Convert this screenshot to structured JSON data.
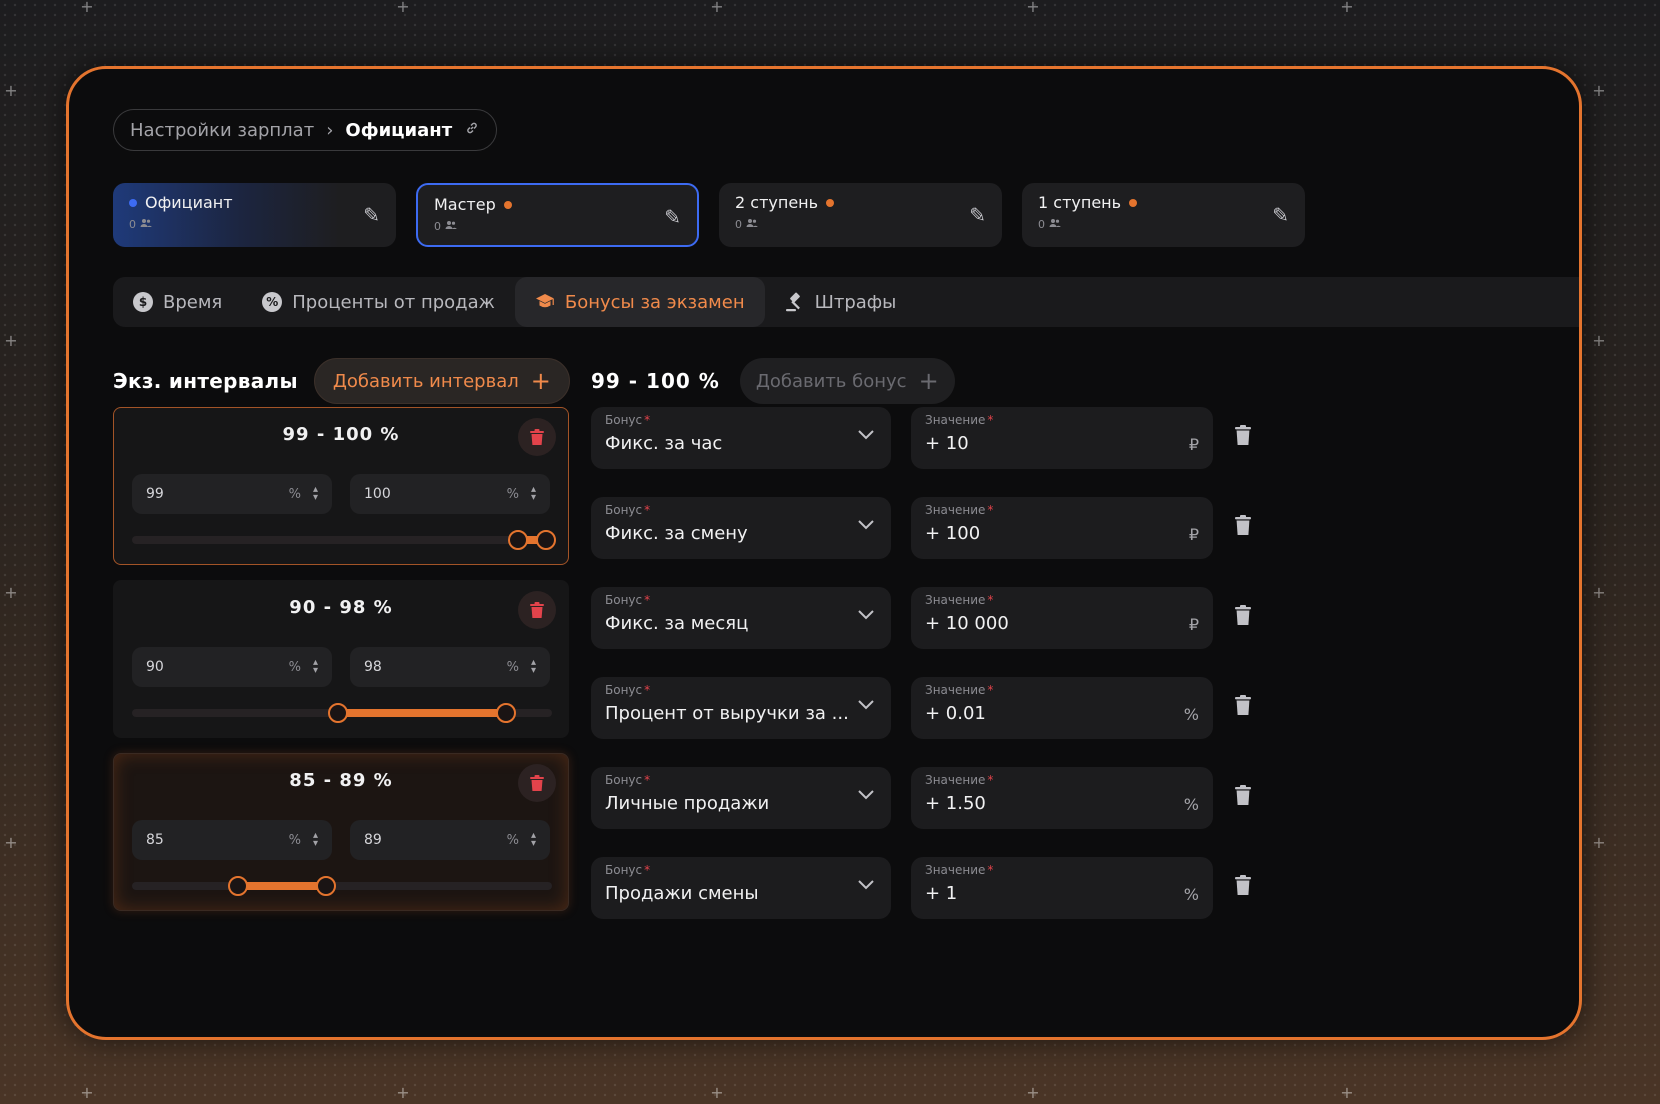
{
  "breadcrumb": {
    "parent": "Настройки зарплат",
    "current": "Официант"
  },
  "roles": [
    {
      "name": "Официант",
      "count": "0",
      "dot_color": "#3d6bf2"
    },
    {
      "name": "Мастер",
      "count": "0",
      "dot_color": "#e4742e"
    },
    {
      "name": "2 ступень",
      "count": "0",
      "dot_color": "#e4742e"
    },
    {
      "name": "1 ступень",
      "count": "0",
      "dot_color": "#e4742e"
    }
  ],
  "tabs": [
    {
      "label": "Время",
      "icon": "dollar-icon"
    },
    {
      "label": "Проценты от продаж",
      "icon": "percent-icon"
    },
    {
      "label": "Бонусы за экзамен",
      "icon": "graduation-cap-icon",
      "active": true
    },
    {
      "label": "Штрафы",
      "icon": "gavel-icon"
    }
  ],
  "intervals_section": {
    "title": "Экз. интервалы",
    "add_button": "Добавить интервал"
  },
  "intervals": [
    {
      "title": "99 - 100 %",
      "min": "99",
      "max": "100",
      "unit": "%",
      "range_min_fraction": 0.99,
      "range_max_fraction": 1.0
    },
    {
      "title": "90 - 98 %",
      "min": "90",
      "max": "98",
      "unit": "%",
      "range_min_fraction": 0.9,
      "range_max_fraction": 0.98
    },
    {
      "title": "85 - 89 %",
      "min": "85",
      "max": "89",
      "unit": "%",
      "range_min_fraction": 0.85,
      "range_max_fraction": 0.89
    }
  ],
  "bonus_section": {
    "range": "99 - 100 %",
    "add_button": "Добавить бонус"
  },
  "bonus_labels": {
    "bonus": "Бонус",
    "value": "Значение"
  },
  "bonuses": [
    {
      "bonus": "Фикс. за час",
      "value": "+ 10",
      "suffix": "₽"
    },
    {
      "bonus": "Фикс. за смену",
      "value": "+ 100",
      "suffix": "₽"
    },
    {
      "bonus": "Фикс. за месяц",
      "value": "+ 10 000",
      "suffix": "₽"
    },
    {
      "bonus": "Процент от выручки за ...",
      "value": "+ 0.01",
      "suffix": "%"
    },
    {
      "bonus": "Личные продажи",
      "value": "+ 1.50",
      "suffix": "%"
    },
    {
      "bonus": "Продажи смены",
      "value": "+ 1",
      "suffix": "%"
    }
  ],
  "colors": {
    "accent": "#e4742e",
    "selected_border": "#3d6bf2",
    "danger": "#e2434b"
  }
}
